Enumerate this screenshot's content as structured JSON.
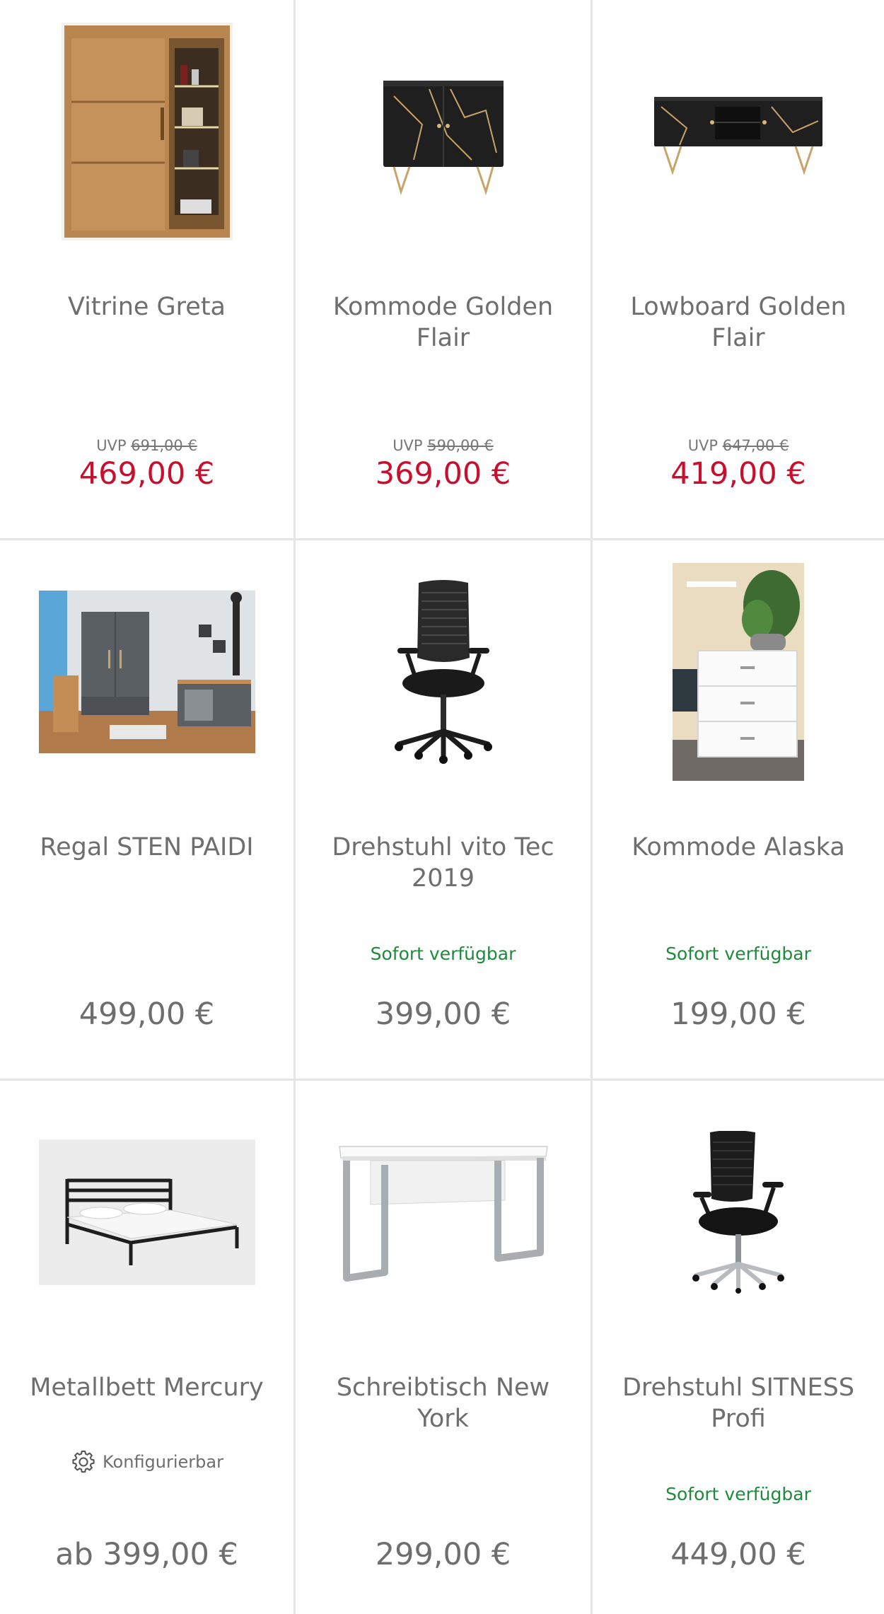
{
  "colors": {
    "sale_price": "#c8102e",
    "availability": "#1e8a3c",
    "text": "#6e6e6e",
    "divider": "#e6e6e6"
  },
  "products": [
    {
      "title": "Vitrine Greta",
      "uvp_label": "UVP",
      "uvp": "691,00 €",
      "price": "469,00 €",
      "sale": true,
      "image_icon": "display-cabinet-image"
    },
    {
      "title": "Kommode Golden Flair",
      "uvp_label": "UVP",
      "uvp": "590,00 €",
      "price": "369,00 €",
      "sale": true,
      "image_icon": "dresser-image"
    },
    {
      "title": "Lowboard Golden Flair",
      "uvp_label": "UVP",
      "uvp": "647,00 €",
      "price": "419,00 €",
      "sale": true,
      "image_icon": "lowboard-image"
    },
    {
      "title": "Regal STEN PAIDI",
      "price": "499,00 €",
      "sale": false,
      "image_icon": "kids-room-shelf-image"
    },
    {
      "title": "Drehstuhl vito Tec 2019",
      "availability": "Sofort verfügbar",
      "price": "399,00 €",
      "sale": false,
      "image_icon": "office-chair-image"
    },
    {
      "title": "Kommode Alaska",
      "availability": "Sofort verfügbar",
      "price": "199,00 €",
      "sale": false,
      "image_icon": "white-dresser-image"
    },
    {
      "title": "Metallbett Mercury",
      "configurable": "Konfigurierbar",
      "price": "ab 399,00 €",
      "sale": false,
      "image_icon": "metal-bed-image"
    },
    {
      "title": "Schreibtisch New York",
      "price": "299,00 €",
      "sale": false,
      "image_icon": "desk-image"
    },
    {
      "title": "Drehstuhl SITNESS Profi",
      "availability": "Sofort verfügbar",
      "price": "449,00 €",
      "sale": false,
      "image_icon": "office-chair-image"
    }
  ]
}
